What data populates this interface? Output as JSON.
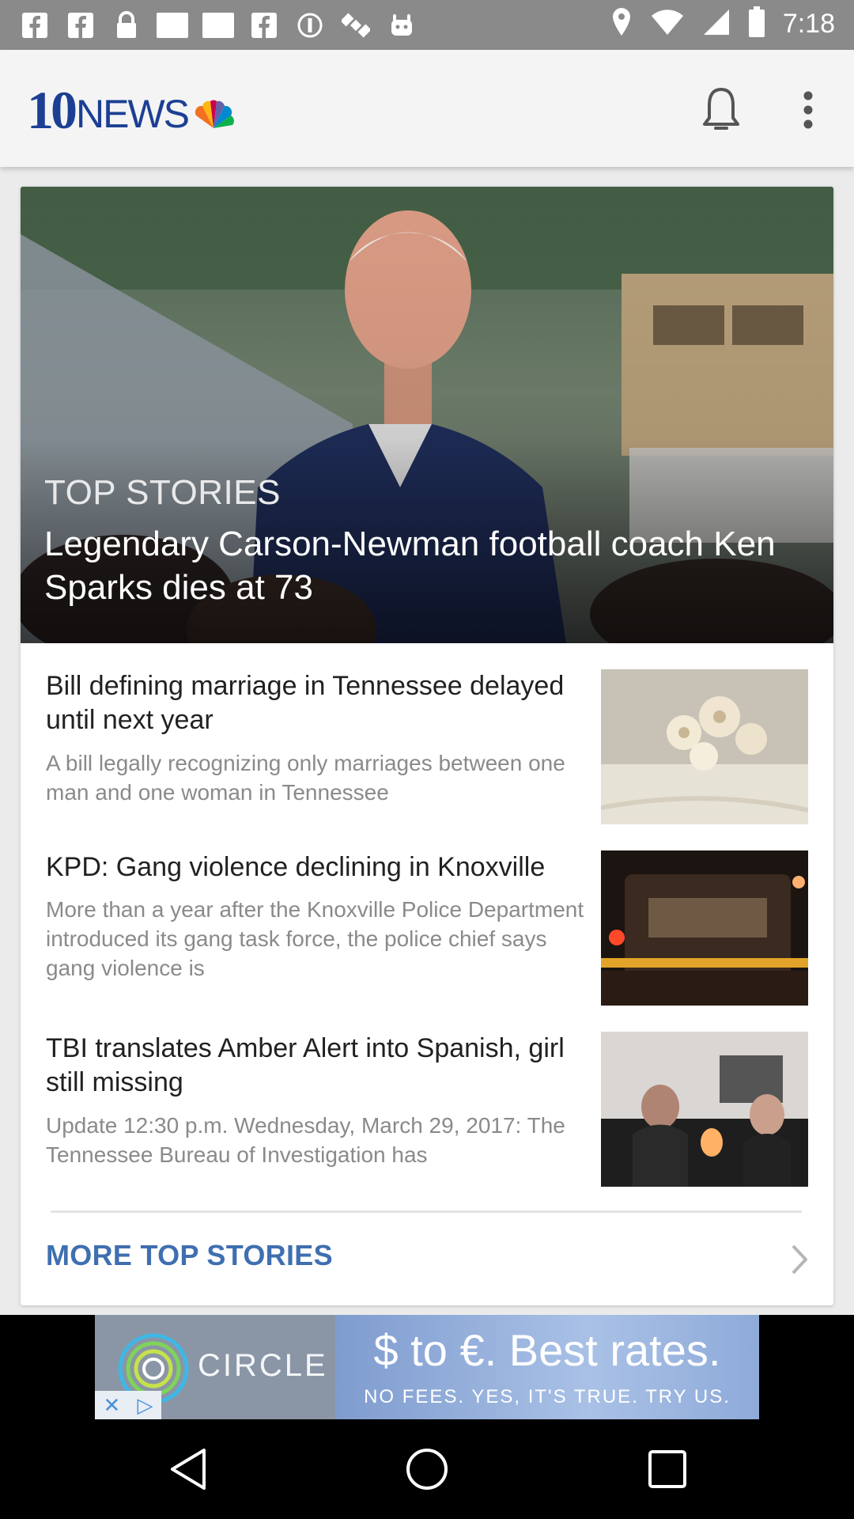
{
  "status_bar": {
    "time": "7:18",
    "left_icons": [
      "facebook-icon",
      "facebook-icon",
      "lock-icon",
      "image-icon",
      "image-icon",
      "facebook-icon",
      "do-not-disturb-icon",
      "satellite-icon",
      "android-icon"
    ],
    "right_icons": [
      "location-icon",
      "wifi-icon",
      "signal-icon",
      "battery-icon"
    ]
  },
  "app_bar": {
    "logo_number": "10",
    "logo_text": "NEWS",
    "icons": [
      "bell-icon",
      "more-vert-icon"
    ],
    "brand_color": "#1c3f94"
  },
  "hero": {
    "kicker": "TOP STORIES",
    "title": "Legendary Carson-Newman football coach Ken Sparks dies at 73"
  },
  "stories": [
    {
      "title": "Bill defining marriage in Tennessee delayed until next year",
      "summary": "A bill legally recognizing only marriages between one man and one woman in Tennessee"
    },
    {
      "title": "KPD: Gang violence declining in Knoxville",
      "summary": "More than a year after the Knoxville Police Department introduced its gang task force, the police chief says gang violence is"
    },
    {
      "title": "TBI translates Amber Alert into Spanish, girl still missing",
      "summary": "Update 12:30 p.m. Wednesday, March 29, 2017: The Tennessee Bureau of Investigation has"
    }
  ],
  "more": {
    "label": "MORE TOP STORIES",
    "color": "#3f6fb0"
  },
  "ad": {
    "brand": "CIRCLE",
    "headline": "$ to €. Best rates.",
    "subline": "NO FEES. YES, IT'S TRUE. TRY US."
  },
  "nav_bar": {
    "icons": [
      "back-icon",
      "home-icon",
      "recents-icon"
    ]
  }
}
